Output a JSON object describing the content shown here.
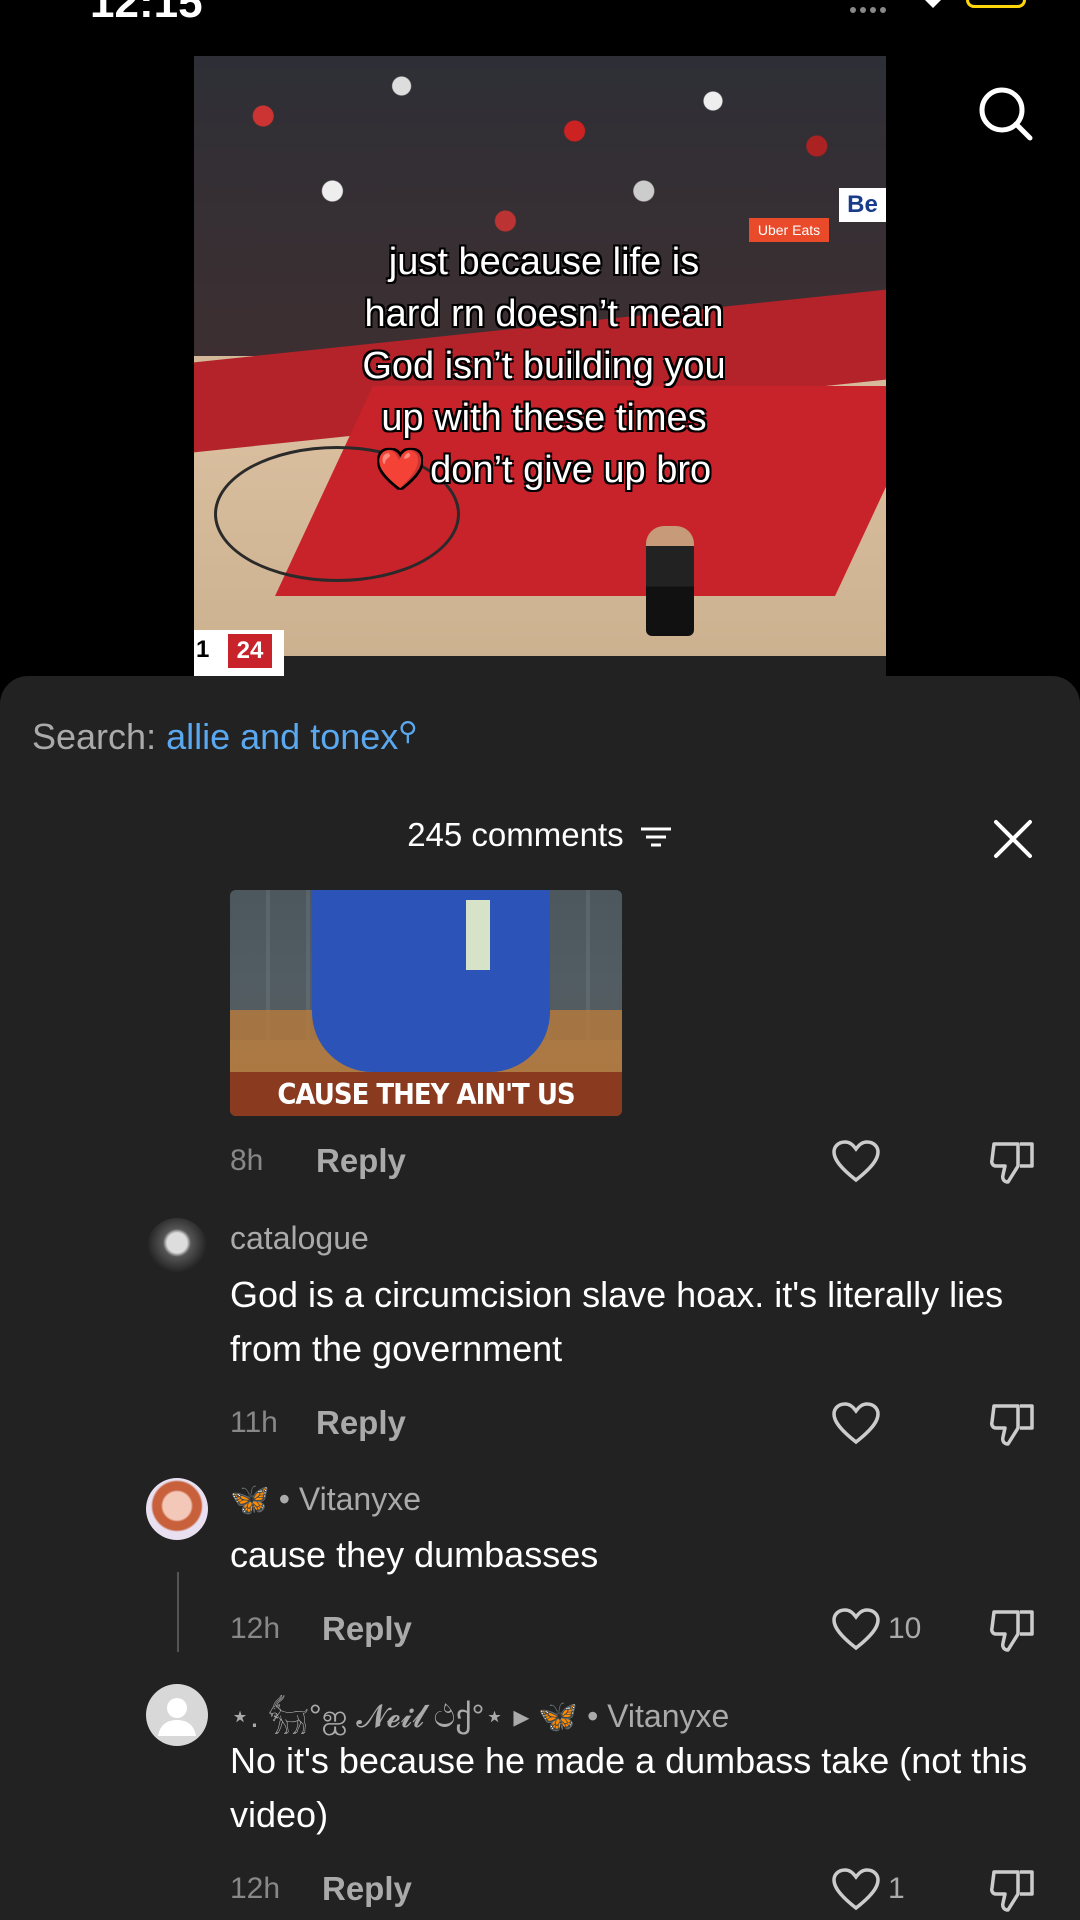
{
  "status_bar": {
    "time": "12:15"
  },
  "video": {
    "caption_lines": [
      "just because life is",
      "hard rn doesn’t mean",
      "God isn’t building you",
      "up with these times",
      "don’t give up bro"
    ],
    "caption_heart": "❤️",
    "sponsor": "Uber Eats",
    "board_text": "Be",
    "score_left": "1",
    "score_right": "24"
  },
  "sheet": {
    "search_label": "Search:",
    "search_term": "allie and tonex",
    "comments_count": "245 comments",
    "meme_caption": "CAUSE THEY AIN'T US",
    "meme_time": "8h",
    "reply_label": "Reply"
  },
  "comments": [
    {
      "username": "catalogue",
      "text": "God is a circumcision slave hoax. it's literally lies from the government",
      "time": "11h",
      "reply": "Reply",
      "likes": ""
    },
    {
      "username_prefix": "🦋",
      "username": "• Vitanyxe",
      "text": "cause they dumbasses",
      "time": "12h",
      "reply": "Reply",
      "likes": "10"
    },
    {
      "username": "⋆. 𓃶°ஐ 𝓝𝓮𝓲𝓵 ථქ°⋆ ▸",
      "username_target_prefix": "🦋",
      "username_target": "• Vitanyxe",
      "text": "No it's because he made a dumbass take (not this video)",
      "time": "12h",
      "reply": "Reply",
      "likes": "1"
    }
  ],
  "colors": {
    "sheet_bg": "#222222",
    "link_blue": "#5aa9f0",
    "butterfly_blue": "#3aa0ff"
  }
}
